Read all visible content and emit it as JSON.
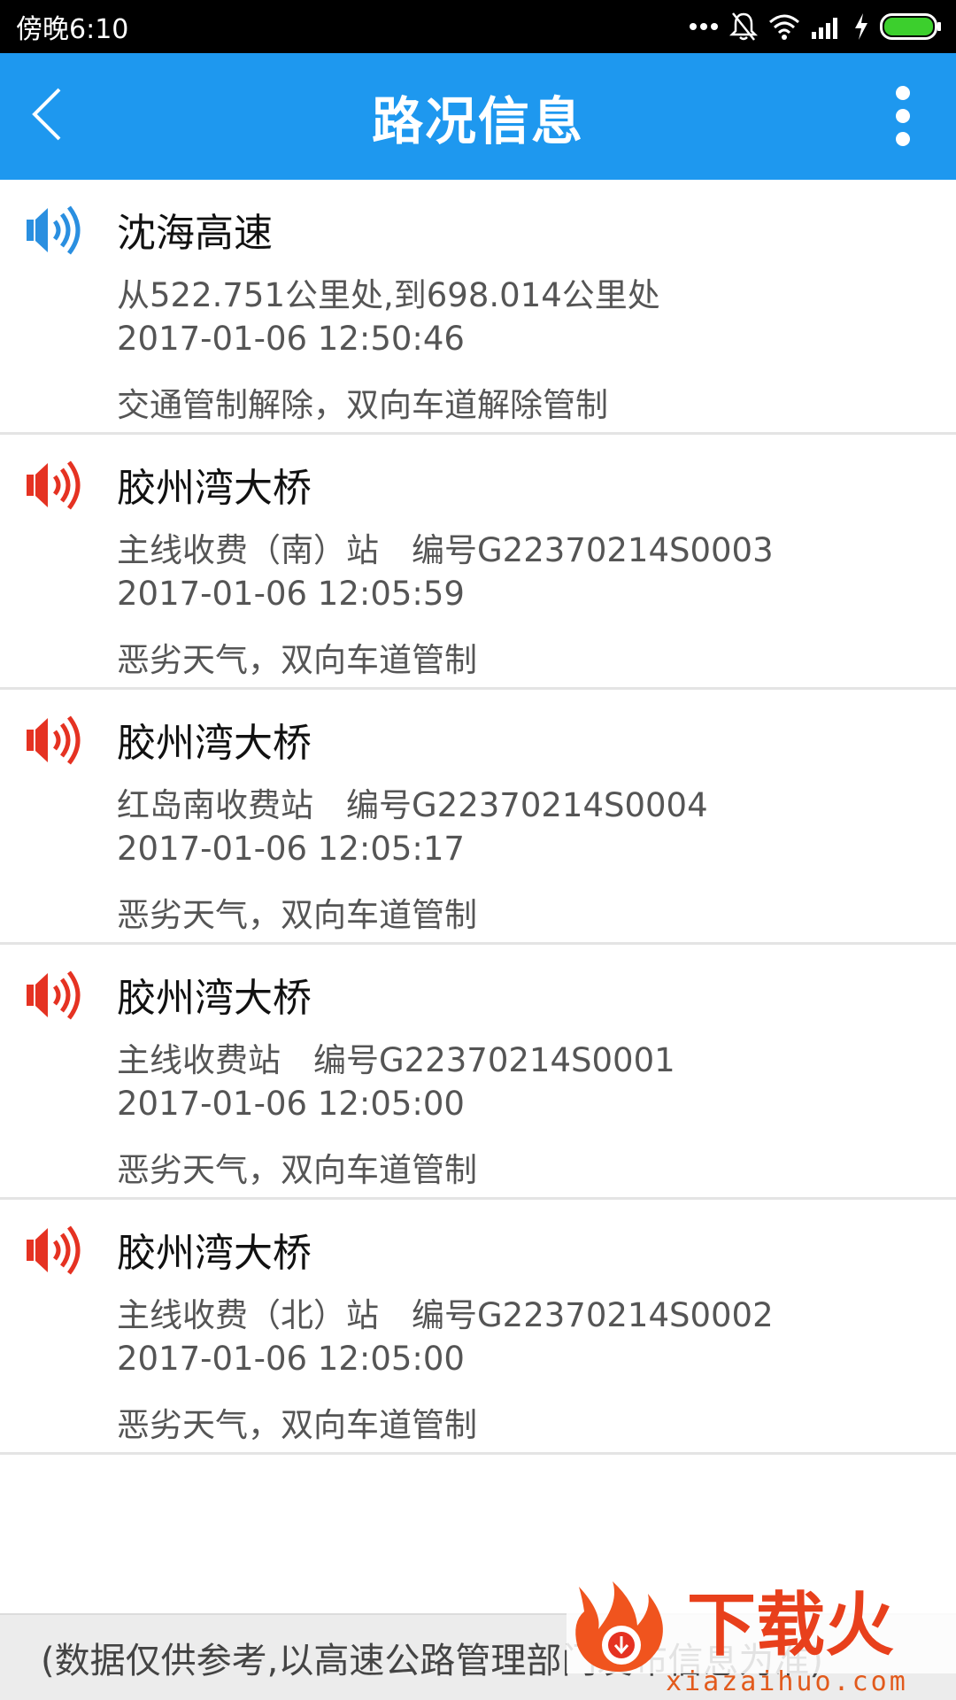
{
  "status_bar": {
    "time": "傍晚6:10",
    "icons": [
      "more-dots-icon",
      "mute-bell-icon",
      "wifi-icon",
      "signal-icon",
      "charging-icon",
      "battery-icon"
    ]
  },
  "app_bar": {
    "title": "路况信息",
    "back_icon": "chevron-left-icon",
    "menu_icon": "overflow-menu-icon",
    "background_color": "#1e98ef"
  },
  "items": [
    {
      "icon": "speaker-blue-icon",
      "icon_color": "#2a8fe0",
      "title": "沈海高速",
      "line1": "从522.751公里处,到698.014公里处",
      "time": "2017-01-06 12:50:46",
      "status": "交通管制解除，双向车道解除管制"
    },
    {
      "icon": "speaker-red-icon",
      "icon_color": "#e53222",
      "title": "胶州湾大桥",
      "line1": "主线收费（南）站　编号G22370214S0003",
      "time": "2017-01-06 12:05:59",
      "status": "恶劣天气，双向车道管制"
    },
    {
      "icon": "speaker-red-icon",
      "icon_color": "#e53222",
      "title": "胶州湾大桥",
      "line1": "红岛南收费站　编号G22370214S0004",
      "time": "2017-01-06 12:05:17",
      "status": "恶劣天气，双向车道管制"
    },
    {
      "icon": "speaker-red-icon",
      "icon_color": "#e53222",
      "title": "胶州湾大桥",
      "line1": "主线收费站　编号G22370214S0001",
      "time": "2017-01-06 12:05:00",
      "status": "恶劣天气，双向车道管制"
    },
    {
      "icon": "speaker-red-icon",
      "icon_color": "#e53222",
      "title": "胶州湾大桥",
      "line1": "主线收费（北）站　编号G22370214S0002",
      "time": "2017-01-06 12:05:00",
      "status": "恶劣天气，双向车道管制"
    }
  ],
  "footer": {
    "text": "(数据仅供参考,以高速公路管理部门发布信息为准)"
  },
  "watermark": {
    "logo_text": "下载火",
    "url": "xiazaihuo.com",
    "color": "#e25a1c"
  }
}
